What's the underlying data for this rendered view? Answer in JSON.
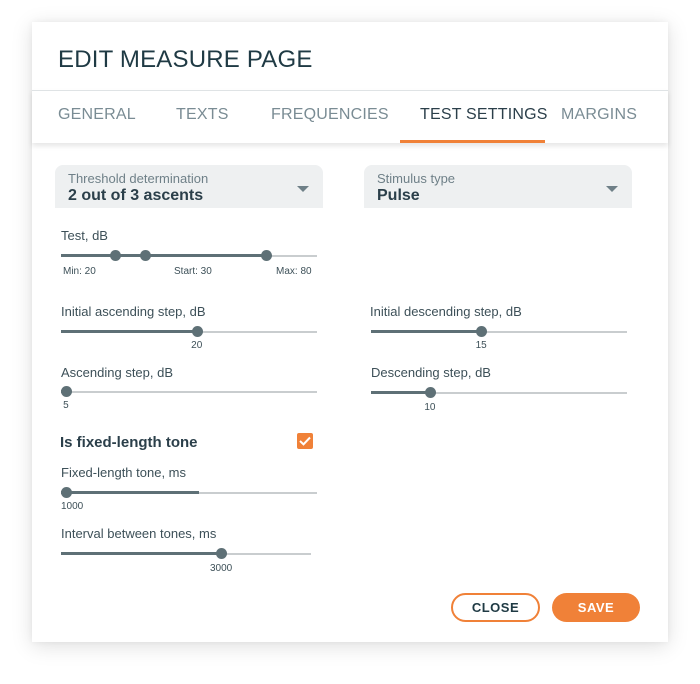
{
  "dialog": {
    "title": "EDIT MEASURE PAGE"
  },
  "tabs": [
    {
      "label": "GENERAL",
      "active": false
    },
    {
      "label": "TEXTS",
      "active": false
    },
    {
      "label": "FREQUENCIES",
      "active": false
    },
    {
      "label": "TEST SETTINGS",
      "active": true
    },
    {
      "label": "MARGINS",
      "active": false
    }
  ],
  "colors": {
    "accent": "#f08138",
    "slider": "#5e7076",
    "text": "#2b3f4a"
  },
  "selects": {
    "threshold": {
      "label": "Threshold determination",
      "value": "2 out of 3 ascents",
      "icon": "dropdown-arrow-icon"
    },
    "stimulus": {
      "label": "Stimulus type",
      "value": "Pulse",
      "icon": "dropdown-arrow-icon"
    }
  },
  "test_db": {
    "label": "Test, dB",
    "min_label": "Min: 20",
    "start_label": "Start: 30",
    "max_label": "Max: 80",
    "min_fraction": 0.21,
    "start_fraction": 0.33,
    "max_fraction": 0.8
  },
  "sliders": {
    "initial_ascending": {
      "label": "Initial ascending step, dB",
      "value": "20",
      "fraction": 0.53
    },
    "ascending": {
      "label": "Ascending step, dB",
      "value": "5",
      "fraction": 0.02
    },
    "initial_descending": {
      "label": "Initial descending step, dB",
      "value": "15",
      "fraction": 0.43
    },
    "descending": {
      "label": "Descending step, dB",
      "value": "10",
      "fraction": 0.23
    },
    "fixed_length": {
      "label": "Fixed-length tone, ms",
      "value": "1000",
      "fraction": 0.02,
      "fill_fraction": 0.54
    },
    "interval": {
      "label": "Interval between tones, ms",
      "value": "3000",
      "fraction": 0.64
    }
  },
  "fixed_tone": {
    "label": "Is fixed-length tone",
    "checked": true
  },
  "buttons": {
    "close": "CLOSE",
    "save": "SAVE"
  }
}
